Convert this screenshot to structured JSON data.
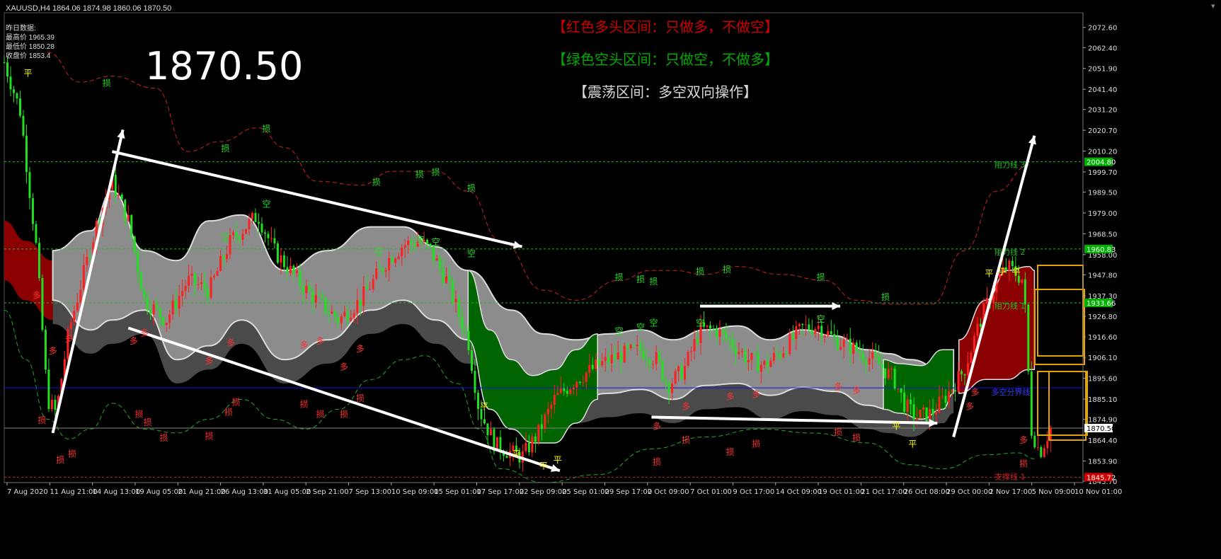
{
  "header": {
    "symbol": "XAUUSD,H4",
    "ohlc": "1864.06 1874.98 1860.06 1870.50"
  },
  "daily_panel": {
    "title": "昨日数据:",
    "high": "最高价 1965.39",
    "low": "最低价 1850.28",
    "close": "收盘价 1853.4"
  },
  "current_price_text": "1870.50",
  "banners": {
    "bull": "【红色多头区间：只做多，不做空】",
    "bear": "【绿色空头区间：只做空，不做多】",
    "range": "【震荡区间：多空双向操作】"
  },
  "colors": {
    "background": "#000000",
    "bull_candle": "#ff2020",
    "bear_candle": "#20e020",
    "band_gray": "#8c8c8c",
    "band_red": "#8b0000",
    "band_green": "#006400",
    "resistance_line": "#1fbf1f",
    "pivot_line": "#0000cc",
    "price_tag_green": "#00b000",
    "price_tag_red": "#d00000",
    "orange_box": "#e6a400"
  },
  "chart_data": {
    "type": "line",
    "title": "XAUUSD,H4",
    "xlabel": "",
    "ylabel": "",
    "ylim": [
      1843.0,
      2080.0
    ],
    "grid": false,
    "x_ticks": [
      "7 Aug 2020",
      "11 Aug 21:00",
      "14 Aug 13:00",
      "19 Aug 05:00",
      "21 Aug 21:00",
      "26 Aug 13:00",
      "31 Aug 05:00",
      "2 Sep 21:00",
      "7 Sep 13:00",
      "10 Sep 09:00",
      "15 Sep 01:00",
      "17 Sep 17:00",
      "22 Sep 09:00",
      "25 Sep 01:00",
      "29 Sep 17:00",
      "2 Oct 09:00",
      "7 Oct 01:00",
      "9 Oct 17:00",
      "14 Oct 09:00",
      "19 Oct 01:00",
      "21 Oct 17:00",
      "26 Oct 08:00",
      "29 Oct 00:00",
      "2 Nov 17:00",
      "5 Nov 09:00",
      "10 Nov 01:00"
    ],
    "y_ticks": [
      "2072.60",
      "2062.40",
      "2051.90",
      "2041.40",
      "2031.20",
      "2020.70",
      "2010.20",
      "1999.70",
      "1989.50",
      "1979.00",
      "1968.50",
      "1958.00",
      "1947.80",
      "1937.30",
      "1926.80",
      "1916.60",
      "1906.10",
      "1895.60",
      "1885.10",
      "1874.90",
      "1864.40",
      "1853.90",
      "1843.70"
    ],
    "price_path": [
      [
        0,
        2055
      ],
      [
        0.015,
        2030
      ],
      [
        0.03,
        1960
      ],
      [
        0.04,
        1885
      ],
      [
        0.048,
        1878
      ],
      [
        0.06,
        1920
      ],
      [
        0.085,
        1972
      ],
      [
        0.1,
        1995
      ],
      [
        0.115,
        1975
      ],
      [
        0.13,
        1935
      ],
      [
        0.15,
        1925
      ],
      [
        0.17,
        1945
      ],
      [
        0.19,
        1940
      ],
      [
        0.21,
        1965
      ],
      [
        0.235,
        1978
      ],
      [
        0.25,
        1960
      ],
      [
        0.28,
        1940
      ],
      [
        0.31,
        1925
      ],
      [
        0.33,
        1935
      ],
      [
        0.355,
        1955
      ],
      [
        0.37,
        1963
      ],
      [
        0.385,
        1965
      ],
      [
        0.395,
        1960
      ],
      [
        0.41,
        1945
      ],
      [
        0.43,
        1915
      ],
      [
        0.44,
        1880
      ],
      [
        0.455,
        1862
      ],
      [
        0.47,
        1858
      ],
      [
        0.48,
        1856
      ],
      [
        0.495,
        1868
      ],
      [
        0.51,
        1885
      ],
      [
        0.53,
        1895
      ],
      [
        0.55,
        1902
      ],
      [
        0.57,
        1907
      ],
      [
        0.59,
        1910
      ],
      [
        0.605,
        1905
      ],
      [
        0.615,
        1892
      ],
      [
        0.63,
        1900
      ],
      [
        0.645,
        1920
      ],
      [
        0.66,
        1920
      ],
      [
        0.675,
        1913
      ],
      [
        0.69,
        1905
      ],
      [
        0.705,
        1902
      ],
      [
        0.72,
        1909
      ],
      [
        0.74,
        1921
      ],
      [
        0.755,
        1922
      ],
      [
        0.77,
        1915
      ],
      [
        0.79,
        1910
      ],
      [
        0.81,
        1903
      ],
      [
        0.825,
        1895
      ],
      [
        0.835,
        1882
      ],
      [
        0.845,
        1876
      ],
      [
        0.86,
        1878
      ],
      [
        0.875,
        1888
      ],
      [
        0.89,
        1900
      ],
      [
        0.905,
        1925
      ],
      [
        0.92,
        1945
      ],
      [
        0.93,
        1952
      ],
      [
        0.945,
        1945
      ],
      [
        0.952,
        1870
      ],
      [
        0.96,
        1858
      ],
      [
        0.97,
        1870.5
      ]
    ],
    "gray_band": [
      [
        0.045,
        1960,
        1935
      ],
      [
        0.08,
        1970,
        1920
      ],
      [
        0.1,
        1990,
        1925
      ],
      [
        0.13,
        1960,
        1930
      ],
      [
        0.16,
        1955,
        1905
      ],
      [
        0.19,
        1975,
        1912
      ],
      [
        0.22,
        1978,
        1925
      ],
      [
        0.26,
        1950,
        1905
      ],
      [
        0.3,
        1960,
        1915
      ],
      [
        0.34,
        1972,
        1930
      ],
      [
        0.37,
        1972,
        1935
      ],
      [
        0.4,
        1962,
        1925
      ],
      [
        0.43,
        1950,
        1915
      ],
      [
        0.47,
        1930,
        1895
      ],
      [
        0.5,
        1918,
        1888
      ],
      [
        0.53,
        1915,
        1885
      ],
      [
        0.56,
        1918,
        1888
      ],
      [
        0.59,
        1920,
        1890
      ],
      [
        0.62,
        1915,
        1885
      ],
      [
        0.65,
        1920,
        1892
      ],
      [
        0.68,
        1922,
        1893
      ],
      [
        0.71,
        1915,
        1887
      ],
      [
        0.74,
        1920,
        1891
      ],
      [
        0.77,
        1917,
        1889
      ],
      [
        0.8,
        1910,
        1882
      ],
      [
        0.82,
        1908,
        1880
      ],
      [
        0.84,
        1905,
        1878
      ],
      [
        0.87,
        1900,
        1885
      ],
      [
        0.88,
        1910,
        1890
      ]
    ],
    "green_band": [
      [
        0.43,
        1950,
        1915
      ],
      [
        0.45,
        1920,
        1880
      ],
      [
        0.47,
        1905,
        1870
      ],
      [
        0.49,
        1897,
        1863
      ],
      [
        0.51,
        1900,
        1863
      ],
      [
        0.53,
        1910,
        1873
      ],
      [
        0.55,
        1918,
        1885
      ]
    ],
    "green_band_2": [
      [
        0.815,
        1905,
        1880
      ],
      [
        0.83,
        1903,
        1878
      ],
      [
        0.85,
        1902,
        1875
      ],
      [
        0.87,
        1910,
        1880
      ],
      [
        0.88,
        1910,
        1888
      ]
    ],
    "red_band_left": [
      [
        0,
        1975,
        1945
      ],
      [
        0.02,
        1965,
        1935
      ],
      [
        0.045,
        1955,
        1925
      ]
    ],
    "red_band_right": [
      [
        0.885,
        1915,
        1888
      ],
      [
        0.91,
        1935,
        1895
      ],
      [
        0.93,
        1950,
        1895
      ],
      [
        0.95,
        1952,
        1900
      ],
      [
        0.955,
        1950,
        1900
      ]
    ],
    "upper_dashed": [
      [
        0.04,
        2060
      ],
      [
        0.07,
        2045
      ],
      [
        0.1,
        2048
      ],
      [
        0.14,
        2042
      ],
      [
        0.17,
        2010
      ],
      [
        0.2,
        2015
      ],
      [
        0.235,
        2022
      ],
      [
        0.26,
        2012
      ],
      [
        0.29,
        1995
      ],
      [
        0.33,
        1993
      ],
      [
        0.36,
        2000
      ],
      [
        0.4,
        2000
      ],
      [
        0.43,
        1990
      ],
      [
        0.46,
        1965
      ],
      [
        0.5,
        1940
      ],
      [
        0.53,
        1935
      ],
      [
        0.57,
        1945
      ],
      [
        0.6,
        1950
      ],
      [
        0.62,
        1950
      ],
      [
        0.65,
        1948
      ],
      [
        0.68,
        1952
      ],
      [
        0.72,
        1948
      ],
      [
        0.76,
        1945
      ],
      [
        0.79,
        1935
      ],
      [
        0.82,
        1933
      ],
      [
        0.86,
        1933
      ],
      [
        0.89,
        1960
      ],
      [
        0.92,
        1990
      ],
      [
        0.95,
        2003
      ]
    ],
    "lower_dashed": [
      [
        0,
        1930
      ],
      [
        0.02,
        1905
      ],
      [
        0.04,
        1875
      ],
      [
        0.06,
        1865
      ],
      [
        0.08,
        1870
      ],
      [
        0.1,
        1883
      ],
      [
        0.13,
        1870
      ],
      [
        0.16,
        1868
      ],
      [
        0.19,
        1875
      ],
      [
        0.22,
        1885
      ],
      [
        0.25,
        1875
      ],
      [
        0.28,
        1870
      ],
      [
        0.31,
        1880
      ],
      [
        0.34,
        1895
      ],
      [
        0.37,
        1905
      ],
      [
        0.39,
        1907
      ],
      [
        0.42,
        1893
      ],
      [
        0.44,
        1870
      ],
      [
        0.46,
        1850
      ],
      [
        0.5,
        1843
      ],
      [
        0.55,
        1847
      ],
      [
        0.6,
        1860
      ],
      [
        0.65,
        1866
      ],
      [
        0.7,
        1870
      ],
      [
        0.75,
        1868
      ],
      [
        0.8,
        1863
      ],
      [
        0.84,
        1852
      ],
      [
        0.87,
        1850
      ],
      [
        0.91,
        1857
      ],
      [
        0.94,
        1858
      ],
      [
        0.955,
        1855
      ]
    ],
    "horizontal_lines": [
      {
        "name": "阻力线 3",
        "value": 2004.8,
        "color": "green"
      },
      {
        "name": "阻力线 2",
        "value": 1960.83,
        "color": "green"
      },
      {
        "name": "阻力线 1",
        "value": 1933.66,
        "color": "green"
      },
      {
        "name": "多空分界线",
        "value": 1890.8,
        "color": "blue"
      },
      {
        "name": "",
        "value": 1870.5,
        "color": "gray"
      },
      {
        "name": "支撑线 1",
        "value": 1845.72,
        "color": "red"
      }
    ],
    "price_tags": [
      {
        "label": "2004.80",
        "value": 2004.8,
        "color": "green"
      },
      {
        "label": "1960.83",
        "value": 1960.83,
        "color": "green"
      },
      {
        "label": "1933.66",
        "value": 1933.66,
        "color": "green"
      },
      {
        "label": "1870.50",
        "value": 1870.5,
        "color": "white"
      },
      {
        "label": "1845.72",
        "value": 1845.72,
        "color": "red"
      }
    ],
    "arrows": [
      [
        [
          0.045,
          1868
        ],
        [
          0.11,
          2021
        ]
      ],
      [
        [
          0.1,
          2010
        ],
        [
          0.48,
          1962
        ]
      ],
      [
        [
          0.115,
          1921
        ],
        [
          0.515,
          1849
        ]
      ],
      [
        [
          0.645,
          1932
        ],
        [
          0.775,
          1932
        ]
      ],
      [
        [
          0.6,
          1876
        ],
        [
          0.865,
          1873
        ]
      ],
      [
        [
          0.88,
          1866
        ],
        [
          0.955,
          2018
        ]
      ]
    ],
    "markers": [
      {
        "t": "平",
        "x": 0.022,
        "y": 2048,
        "c": "#ffff00"
      },
      {
        "t": "损",
        "x": 0.095,
        "y": 2043,
        "c": "#22dd22"
      },
      {
        "t": "损",
        "x": 0.205,
        "y": 2010,
        "c": "#22dd22"
      },
      {
        "t": "损",
        "x": 0.243,
        "y": 2020,
        "c": "#22dd22"
      },
      {
        "t": "损",
        "x": 0.345,
        "y": 1993,
        "c": "#22dd22"
      },
      {
        "t": "损",
        "x": 0.385,
        "y": 1997,
        "c": "#22dd22"
      },
      {
        "t": "损",
        "x": 0.4,
        "y": 1998,
        "c": "#22dd22"
      },
      {
        "t": "损",
        "x": 0.433,
        "y": 1990,
        "c": "#22dd22"
      },
      {
        "t": "空",
        "x": 0.205,
        "y": 1965,
        "c": "#22dd22"
      },
      {
        "t": "空",
        "x": 0.243,
        "y": 1982,
        "c": "#22dd22"
      },
      {
        "t": "空",
        "x": 0.347,
        "y": 1958,
        "c": "#22dd22"
      },
      {
        "t": "空",
        "x": 0.386,
        "y": 1964,
        "c": "#22dd22"
      },
      {
        "t": "空",
        "x": 0.4,
        "y": 1963,
        "c": "#22dd22"
      },
      {
        "t": "空",
        "x": 0.433,
        "y": 1957,
        "c": "#22dd22"
      },
      {
        "t": "空",
        "x": 0.57,
        "y": 1918,
        "c": "#22dd22"
      },
      {
        "t": "空",
        "x": 0.59,
        "y": 1920,
        "c": "#22dd22"
      },
      {
        "t": "空",
        "x": 0.602,
        "y": 1922,
        "c": "#22dd22"
      },
      {
        "t": "空",
        "x": 0.645,
        "y": 1922,
        "c": "#22dd22"
      },
      {
        "t": "空",
        "x": 0.757,
        "y": 1924,
        "c": "#22dd22"
      },
      {
        "t": "损",
        "x": 0.57,
        "y": 1945,
        "c": "#22dd22"
      },
      {
        "t": "损",
        "x": 0.59,
        "y": 1944,
        "c": "#22dd22"
      },
      {
        "t": "损",
        "x": 0.602,
        "y": 1943,
        "c": "#22dd22"
      },
      {
        "t": "损",
        "x": 0.645,
        "y": 1948,
        "c": "#22dd22"
      },
      {
        "t": "损",
        "x": 0.67,
        "y": 1949,
        "c": "#22dd22"
      },
      {
        "t": "损",
        "x": 0.757,
        "y": 1945,
        "c": "#22dd22"
      },
      {
        "t": "损",
        "x": 0.817,
        "y": 1935,
        "c": "#22dd22"
      },
      {
        "t": "多",
        "x": 0.03,
        "y": 1936,
        "c": "#ff3030"
      },
      {
        "t": "多",
        "x": 0.045,
        "y": 1908,
        "c": "#ff3030"
      },
      {
        "t": "多",
        "x": 0.06,
        "y": 1914,
        "c": "#ff3030"
      },
      {
        "t": "多",
        "x": 0.12,
        "y": 1913,
        "c": "#ff3030"
      },
      {
        "t": "多",
        "x": 0.13,
        "y": 1917,
        "c": "#ff3030"
      },
      {
        "t": "多",
        "x": 0.19,
        "y": 1903,
        "c": "#ff3030"
      },
      {
        "t": "多",
        "x": 0.21,
        "y": 1912,
        "c": "#ff3030"
      },
      {
        "t": "多",
        "x": 0.278,
        "y": 1911,
        "c": "#ff3030"
      },
      {
        "t": "多",
        "x": 0.293,
        "y": 1913,
        "c": "#ff3030"
      },
      {
        "t": "多",
        "x": 0.315,
        "y": 1900,
        "c": "#ff3030"
      },
      {
        "t": "多",
        "x": 0.33,
        "y": 1909,
        "c": "#ff3030"
      },
      {
        "t": "损",
        "x": 0.035,
        "y": 1873,
        "c": "#ff3030"
      },
      {
        "t": "损",
        "x": 0.052,
        "y": 1853,
        "c": "#ff3030"
      },
      {
        "t": "损",
        "x": 0.063,
        "y": 1856,
        "c": "#ff3030"
      },
      {
        "t": "损",
        "x": 0.125,
        "y": 1876,
        "c": "#ff3030"
      },
      {
        "t": "损",
        "x": 0.133,
        "y": 1872,
        "c": "#ff3030"
      },
      {
        "t": "损",
        "x": 0.148,
        "y": 1864,
        "c": "#ff3030"
      },
      {
        "t": "损",
        "x": 0.19,
        "y": 1865,
        "c": "#ff3030"
      },
      {
        "t": "损",
        "x": 0.208,
        "y": 1877,
        "c": "#ff3030"
      },
      {
        "t": "损",
        "x": 0.215,
        "y": 1882,
        "c": "#ff3030"
      },
      {
        "t": "损",
        "x": 0.278,
        "y": 1881,
        "c": "#ff3030"
      },
      {
        "t": "损",
        "x": 0.293,
        "y": 1876,
        "c": "#ff3030"
      },
      {
        "t": "损",
        "x": 0.315,
        "y": 1876,
        "c": "#ff3030"
      },
      {
        "t": "损",
        "x": 0.33,
        "y": 1884,
        "c": "#ff3030"
      },
      {
        "t": "平",
        "x": 0.445,
        "y": 1880,
        "c": "#ffff00"
      },
      {
        "t": "平",
        "x": 0.475,
        "y": 1856,
        "c": "#ffff00"
      },
      {
        "t": "平",
        "x": 0.5,
        "y": 1850,
        "c": "#ffff00"
      },
      {
        "t": "平",
        "x": 0.513,
        "y": 1853,
        "c": "#ffff00"
      },
      {
        "t": "多",
        "x": 0.605,
        "y": 1870,
        "c": "#ff3030"
      },
      {
        "t": "多",
        "x": 0.632,
        "y": 1880,
        "c": "#ff3030"
      },
      {
        "t": "多",
        "x": 0.673,
        "y": 1885,
        "c": "#ff3030"
      },
      {
        "t": "多",
        "x": 0.697,
        "y": 1886,
        "c": "#ff3030"
      },
      {
        "t": "多",
        "x": 0.773,
        "y": 1890,
        "c": "#ff3030"
      },
      {
        "t": "多",
        "x": 0.79,
        "y": 1888,
        "c": "#ff3030"
      },
      {
        "t": "损",
        "x": 0.605,
        "y": 1852,
        "c": "#ff3030"
      },
      {
        "t": "损",
        "x": 0.632,
        "y": 1863,
        "c": "#ff3030"
      },
      {
        "t": "损",
        "x": 0.673,
        "y": 1857,
        "c": "#ff3030"
      },
      {
        "t": "损",
        "x": 0.697,
        "y": 1861,
        "c": "#ff3030"
      },
      {
        "t": "损",
        "x": 0.773,
        "y": 1867,
        "c": "#ff3030"
      },
      {
        "t": "损",
        "x": 0.79,
        "y": 1864,
        "c": "#ff3030"
      },
      {
        "t": "平",
        "x": 0.827,
        "y": 1870,
        "c": "#ffff00"
      },
      {
        "t": "平",
        "x": 0.842,
        "y": 1861,
        "c": "#ffff00"
      },
      {
        "t": "平",
        "x": 0.913,
        "y": 1947,
        "c": "#ffff00"
      },
      {
        "t": "平",
        "x": 0.925,
        "y": 1948,
        "c": "#ffff00"
      },
      {
        "t": "平",
        "x": 0.938,
        "y": 1948,
        "c": "#ffff00"
      },
      {
        "t": "多",
        "x": 0.895,
        "y": 1880,
        "c": "#ff3030"
      },
      {
        "t": "多",
        "x": 0.9,
        "y": 1887,
        "c": "#ff3030"
      },
      {
        "t": "多",
        "x": 0.945,
        "y": 1863,
        "c": "#ff3030"
      },
      {
        "t": "损",
        "x": 0.945,
        "y": 1851,
        "c": "#ff3030"
      }
    ]
  }
}
